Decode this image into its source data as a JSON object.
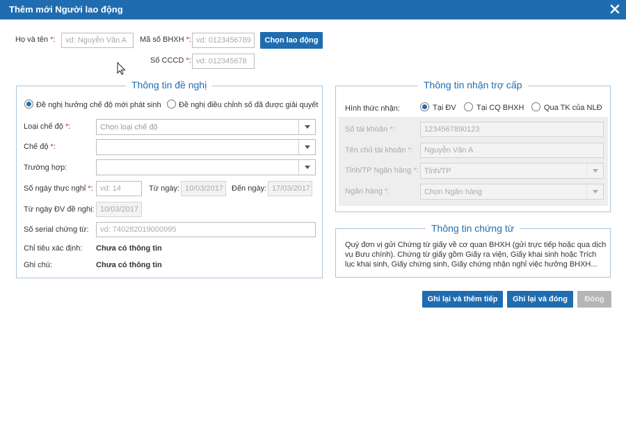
{
  "dialog": {
    "title": "Thêm mới Người lao động"
  },
  "top": {
    "name_label": "Họ và tên",
    "name_placeholder": "vd: Nguyễn Văn A",
    "bhxh_label": "Mã số BHXH",
    "bhxh_placeholder": "vd: 0123456789",
    "choose_button": "Chọn lao động",
    "cccd_label": "Số CCCD",
    "cccd_placeholder": "vd: 012345678",
    "required_mark": "*"
  },
  "proposal": {
    "title": "Thông tin đề nghị",
    "radio_new": "Đề nghị hưởng chế độ mới phát sinh",
    "radio_adjust": "Đề nghị điều chỉnh số đã được giải quyết",
    "regime_type_label": "Loại chế độ",
    "regime_type_placeholder": "Chọn loại chế độ",
    "regime_label": "Chế độ",
    "regime_value": "",
    "case_label": "Trường hợp:",
    "case_value": "",
    "days_label": "Số ngày thực nghỉ",
    "days_placeholder": "vd: 14",
    "from_label": "Từ ngày:",
    "from_value": "10/03/2017",
    "to_label": "Đến ngày:",
    "to_value": "17/03/2017",
    "from_dv_label": "Từ ngày ĐV đề nghị:",
    "from_dv_value": "10/03/2017",
    "serial_label": "Số serial chứng từ:",
    "serial_placeholder": "vd: 740282019000995",
    "indicator_label": "Chỉ tiêu xác định:",
    "indicator_value": "Chưa có thông tin",
    "note_label": "Ghi chú:",
    "note_value": "Chưa có thông tin"
  },
  "benefit": {
    "title": "Thông tin nhận trợ cấp",
    "method_label": "Hình thức nhận:",
    "method_options": [
      "Tại ĐV",
      "Tại CQ BHXH",
      "Qua TK của NLĐ"
    ],
    "account_label": "Số tài khoản",
    "account_value": "1234567890123",
    "owner_label": "Tên chủ tài khoản",
    "owner_value": "Nguyễn Văn A",
    "province_label": "Tỉnh/TP Ngân hàng",
    "province_value": "Tỉnh/TP",
    "bank_label": "Ngân hàng",
    "bank_value": "Chọn Ngân hàng"
  },
  "documents": {
    "title": "Thông tin chứng từ",
    "text": "Quý đơn vị gửi Chứng từ giấy về cơ quan BHXH (gửi trực tiếp hoặc qua dịch vụ Bưu chính). Chứng từ giấy gồm Giấy ra viện, Giấy khai sinh hoặc Trích lục khai sinh, Giấy chứng sinh, Giấy chứng nhận nghỉ việc hưởng BHXH..."
  },
  "actions": {
    "save_continue": "Ghi lại và thêm tiếp",
    "save_close": "Ghi lại và đóng",
    "close": "Đóng"
  },
  "colors": {
    "primary": "#1f6cb0",
    "required": "#d9251c",
    "border": "#a9c3de"
  }
}
